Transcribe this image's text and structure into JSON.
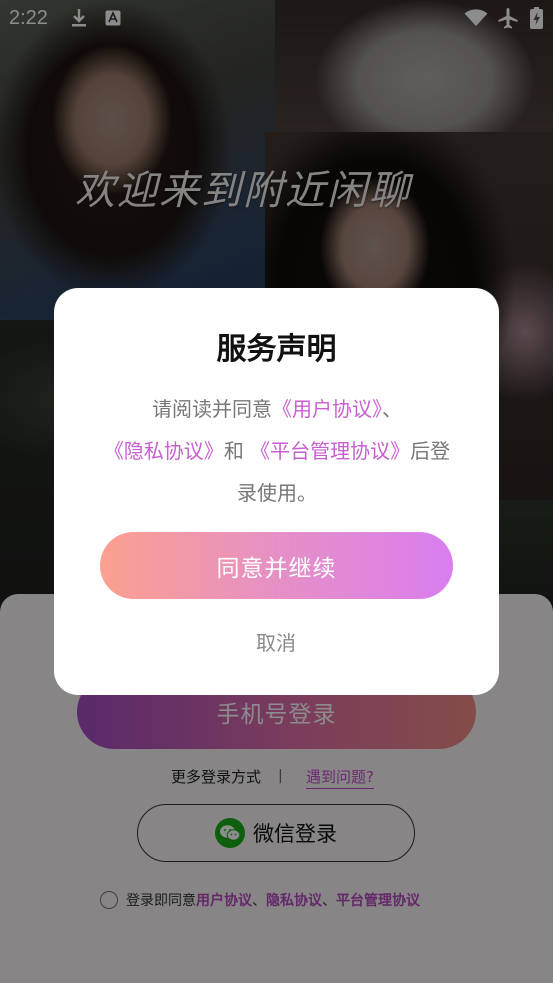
{
  "status_bar": {
    "time": "2:22",
    "left_icons": [
      "download-icon",
      "keyboard-a-icon"
    ],
    "right_icons": [
      "wifi-icon",
      "airplane-icon",
      "battery-charging-icon"
    ]
  },
  "background": {
    "welcome_text": "欢迎来到附近闲聊"
  },
  "login": {
    "phone_login_label": "手机号登录",
    "more_methods_label": "更多登录方式",
    "separator": "|",
    "help_link": "遇到问题?",
    "wechat_login_label": "微信登录",
    "agreement_prefix": "登录即同意 ",
    "agreement_links": [
      "用户协议",
      "隐私协议",
      "平台管理协议"
    ],
    "agreement_sep": "、"
  },
  "dialog": {
    "title": "服务声明",
    "body_prefix": "请阅读并同意",
    "link_user": "《用户协议》",
    "sep1": "、",
    "link_privacy": "《隐私协议》",
    "and_text": "和 ",
    "link_platform": "《平台管理协议》",
    "body_suffix": "后登录使用。",
    "agree_button": "同意并继续",
    "cancel_button": "取消"
  },
  "colors": {
    "accent_link": "#c85fd0",
    "wechat_green": "#1aad19"
  }
}
